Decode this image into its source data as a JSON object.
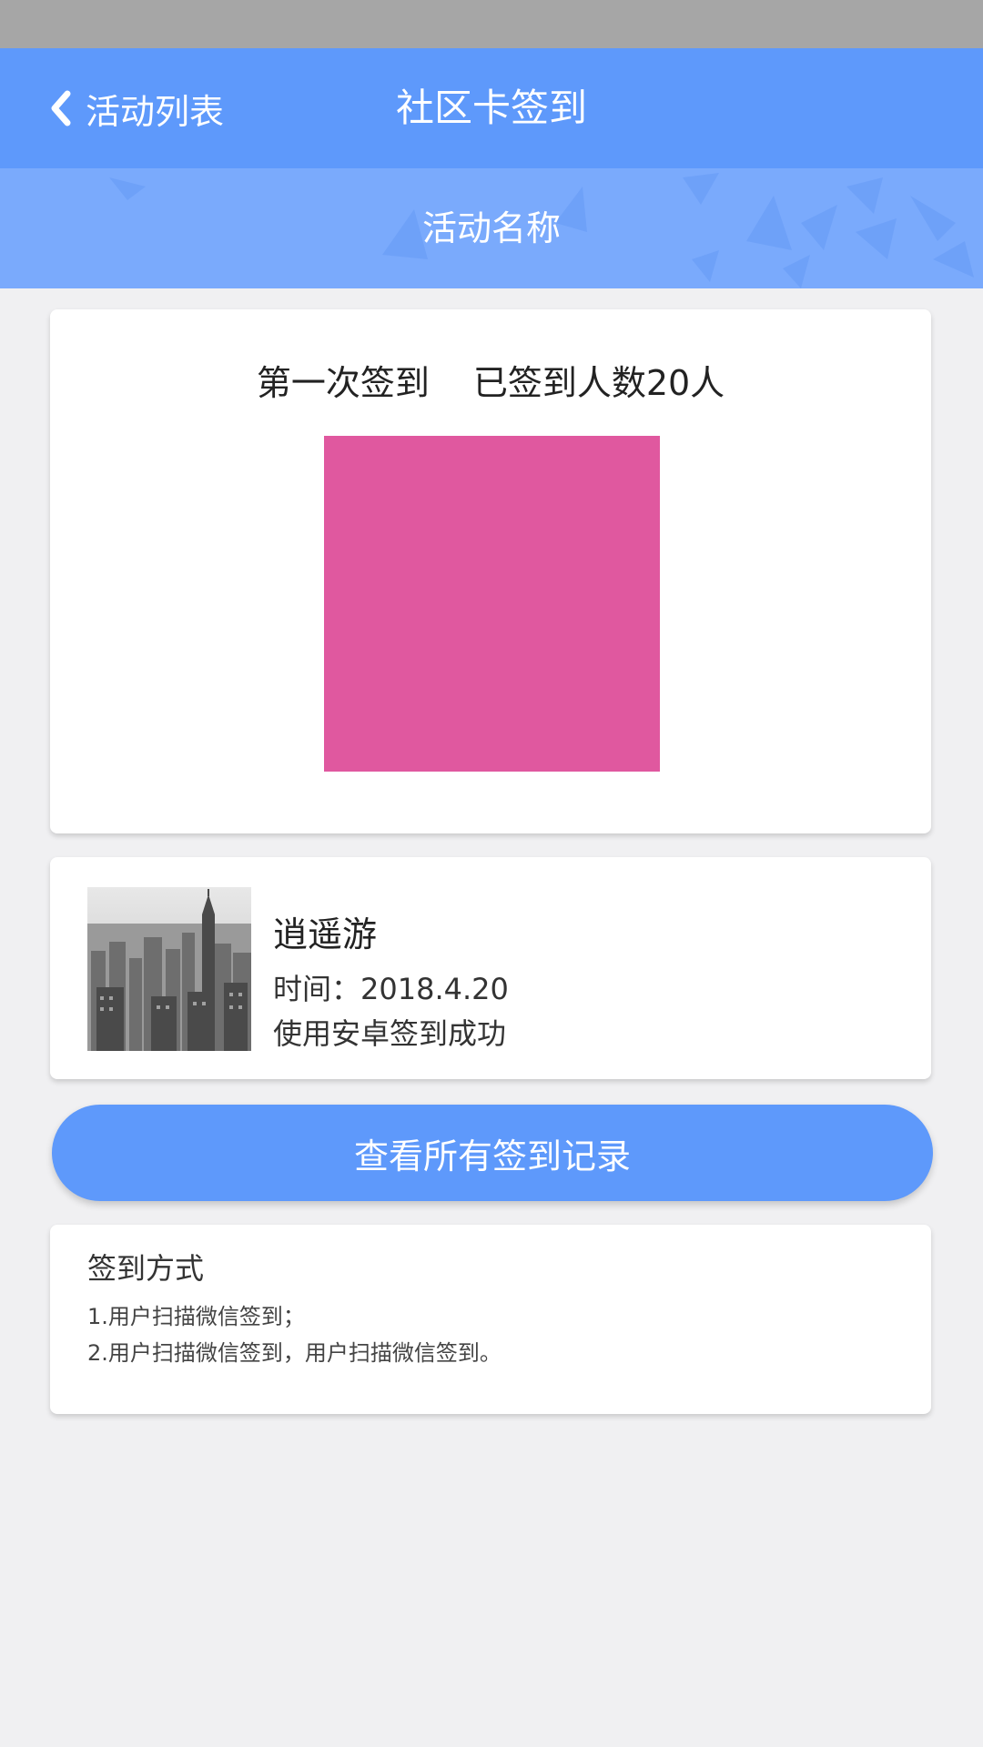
{
  "nav": {
    "back_label": "活动列表",
    "title": "社区卡签到"
  },
  "subheader": {
    "title": "活动名称"
  },
  "signin_card": {
    "round_label": "第一次签到",
    "count_label": "已签到人数20人",
    "qr_color": "#e0589f"
  },
  "latest_record": {
    "name": "逍遥游",
    "time": "时间：2018.4.20",
    "status": "使用安卓签到成功"
  },
  "view_all_button": {
    "label": "查看所有签到记录"
  },
  "signin_methods": {
    "title": "签到方式",
    "lines": [
      "1.用户扫描微信签到；",
      "2.用户扫描微信签到，用户扫描微信签到。"
    ]
  },
  "colors": {
    "status_bar": "#a6a6a6",
    "primary": "#5e99fb",
    "subheader": "#7aaafc",
    "background": "#f0f0f2"
  }
}
